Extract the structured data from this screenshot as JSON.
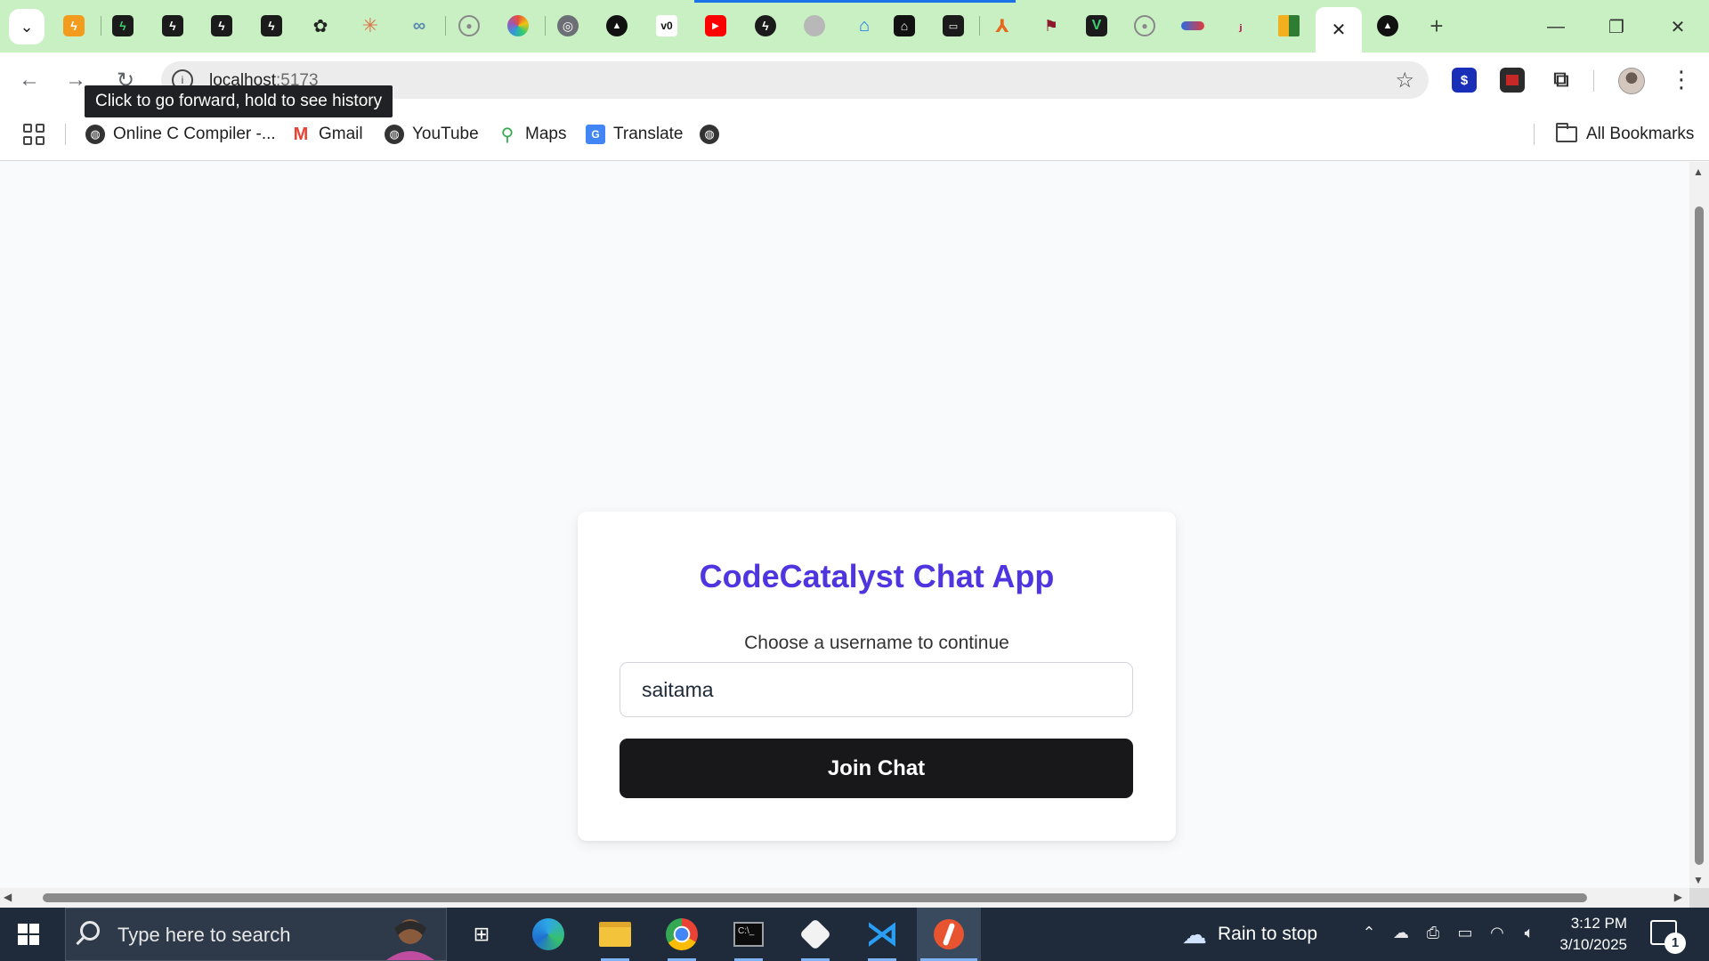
{
  "browser": {
    "tab_icons": [
      "bolt-orange-icon",
      "bolt-green-icon",
      "bolt-black-icon",
      "bolt-black-icon",
      "bolt-black-icon",
      "openai-icon",
      "claude-icon",
      "copilot-icon",
      "github-icon",
      "colorwheel-icon",
      "globe-dark-icon",
      "vercel-icon",
      "v0-icon",
      "youtube-icon",
      "bolt-dark-icon",
      "grey-circle-icon",
      "house-icon",
      "notion-icon",
      "terminal-icon",
      "xpeng-icon",
      "flag-icon",
      "vite-icon",
      "github-icon",
      "wave-icon",
      "jetbrains-icon",
      "grid-icon"
    ],
    "active_tab_close": "✕",
    "after_tab_icon": "vercel-icon",
    "new_tab": "+",
    "window_controls": {
      "minimize": "—",
      "restore": "❐",
      "close": "✕"
    },
    "url_host": "localhost",
    "url_port": ":5173",
    "tooltip": "Click to go forward, hold to see history",
    "bookmarks": [
      {
        "label": "Online C Compiler -...",
        "icon": "globe-icon",
        "color": "#333333"
      },
      {
        "label": "Gmail",
        "icon": "gmail-icon",
        "color": "#ea4335"
      },
      {
        "label": "YouTube",
        "icon": "globe-icon",
        "color": "#333333"
      },
      {
        "label": "Maps",
        "icon": "maps-pin-icon",
        "color": "#34a853"
      },
      {
        "label": "Translate",
        "icon": "translate-icon",
        "color": "#4285f4"
      }
    ],
    "all_bookmarks": "All Bookmarks"
  },
  "page": {
    "title": "CodeCatalyst Chat App",
    "subtitle": "Choose a username to continue",
    "username_value": "saitama",
    "join_button": "Join Chat",
    "title_color": "#4f35e0",
    "button_color": "#18181a"
  },
  "taskbar": {
    "search_placeholder": "Type here to search",
    "apps": [
      "task-view-icon",
      "edge-icon",
      "file-explorer-icon",
      "chrome-icon",
      "terminal-icon",
      "app-cube-icon",
      "vscode-icon",
      "postman-icon"
    ],
    "weather": "Rain to stop",
    "time": "3:12 PM",
    "date": "3/10/2025",
    "notification_count": "1"
  }
}
